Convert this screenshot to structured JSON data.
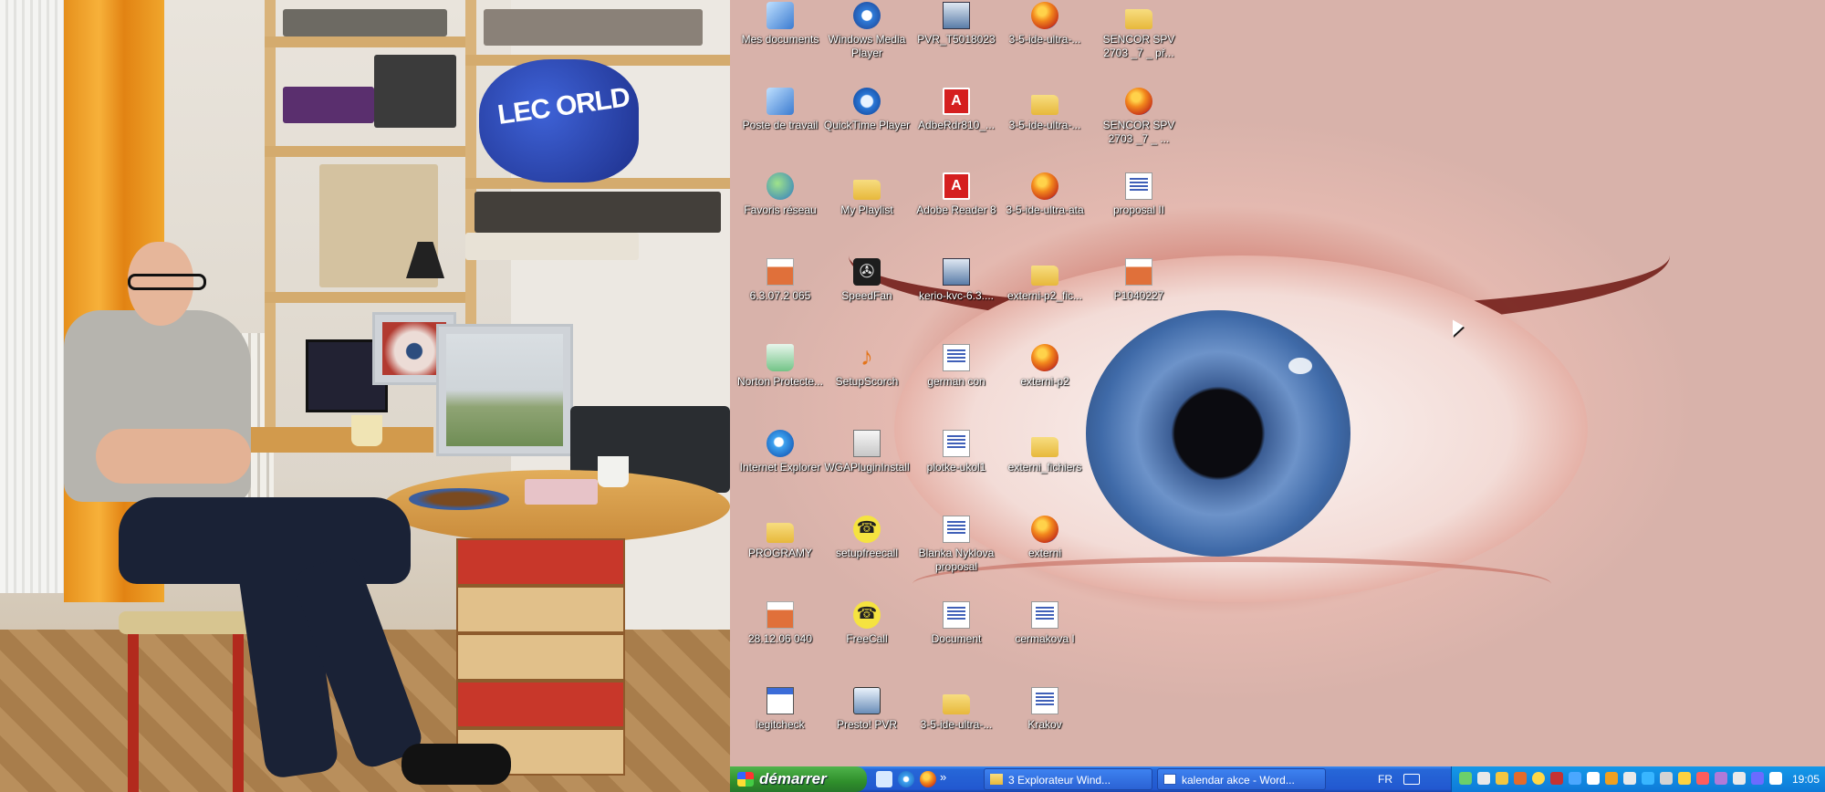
{
  "desktop": {
    "icons": [
      {
        "label": "Mes documents",
        "icon": "folder-docs-icon",
        "type": "sys"
      },
      {
        "label": "Windows Media Player",
        "icon": "windows-media-player-icon",
        "type": "wmp"
      },
      {
        "label": "PVR_T5018023",
        "icon": "pvr-icon",
        "type": "pvr"
      },
      {
        "label": "3-5-ide-ultra-...",
        "icon": "firefox-icon",
        "type": "firefox"
      },
      {
        "label": "SENCOR SPV 2703 _7 _ př...",
        "icon": "folder-icon",
        "type": "folder"
      },
      {
        "label": "Poste de travail",
        "icon": "computer-icon",
        "type": "sys"
      },
      {
        "label": "QuickTime Player",
        "icon": "quicktime-icon",
        "type": "qt"
      },
      {
        "label": "AdbeRdr810_...",
        "icon": "adobe-installer-icon",
        "type": "pdf"
      },
      {
        "label": "3-5-ide-ultra-...",
        "icon": "folder-icon",
        "type": "folder"
      },
      {
        "label": "SENCOR SPV 2703 _7 _ ...",
        "icon": "firefox-icon",
        "type": "firefox"
      },
      {
        "label": "Favoris réseau",
        "icon": "network-icon",
        "type": "net"
      },
      {
        "label": "My Playlist",
        "icon": "folder-icon",
        "type": "folder"
      },
      {
        "label": "Adobe Reader 8",
        "icon": "adobe-reader-icon",
        "type": "pdf"
      },
      {
        "label": "3-5-ide-ultra-ata",
        "icon": "firefox-icon",
        "type": "firefox"
      },
      {
        "label": "proposal II",
        "icon": "document-icon",
        "type": "doc"
      },
      {
        "label": "6.3.07.2 065",
        "icon": "image-icon",
        "type": "img"
      },
      {
        "label": "SpeedFan",
        "icon": "speedfan-icon",
        "type": "fan"
      },
      {
        "label": "kerio-kvc-6.3....",
        "icon": "installer-icon",
        "type": "pvr"
      },
      {
        "label": "externi-p2_fic...",
        "icon": "folder-icon",
        "type": "folder"
      },
      {
        "label": "P1040227",
        "icon": "image-icon",
        "type": "img"
      },
      {
        "label": "Norton Protecte...",
        "icon": "recycle-bin-icon",
        "type": "bin"
      },
      {
        "label": "SetupScorch",
        "icon": "scorch-icon",
        "type": "scorch"
      },
      {
        "label": "german con",
        "icon": "document-icon",
        "type": "doc"
      },
      {
        "label": "externi-p2",
        "icon": "firefox-icon",
        "type": "firefox"
      },
      {
        "label": "Internet Explorer",
        "icon": "internet-explorer-icon",
        "type": "ie"
      },
      {
        "label": "WGAPluginInstall",
        "icon": "wga-installer-icon",
        "type": "wga"
      },
      {
        "label": "plotke-ukol1",
        "icon": "document-icon",
        "type": "doc"
      },
      {
        "label": "externi_fichiers",
        "icon": "folder-icon",
        "type": "folder"
      },
      {
        "label": "PROGRAMY",
        "icon": "folder-icon",
        "type": "folder"
      },
      {
        "label": "setupfreecall",
        "icon": "freecall-icon",
        "type": "phone"
      },
      {
        "label": "Blanka Nyklova proposal",
        "icon": "document-icon",
        "type": "doc"
      },
      {
        "label": "externi",
        "icon": "firefox-icon",
        "type": "firefox"
      },
      {
        "label": "28.12.06 040",
        "icon": "image-icon",
        "type": "img"
      },
      {
        "label": "FreeCall",
        "icon": "freecall-icon",
        "type": "phone"
      },
      {
        "label": "Document",
        "icon": "document-icon",
        "type": "doc"
      },
      {
        "label": "cermakova I",
        "icon": "document-icon",
        "type": "doc"
      },
      {
        "label": "legitcheck",
        "icon": "window-app-icon",
        "type": "win"
      },
      {
        "label": "Presto! PVR",
        "icon": "presto-pvr-icon",
        "type": "preston"
      },
      {
        "label": "3-5-ide-ultra-...",
        "icon": "folder-icon",
        "type": "folder"
      },
      {
        "label": "Krakov",
        "icon": "document-icon",
        "type": "doc"
      }
    ]
  },
  "taskbar": {
    "start_label": "démarrer",
    "quick_launch": [
      "desktop-icon",
      "internet-explorer-icon",
      "firefox-icon"
    ],
    "overflow_label": "»",
    "tasks": [
      {
        "label": "3 Explorateur Wind...",
        "icon": "folder-icon"
      },
      {
        "label": "kalendar akce - Word...",
        "icon": "word-icon"
      }
    ],
    "language": "FR",
    "clock": "19:05"
  },
  "photo": {
    "bag_text": "LEC ORLD"
  },
  "colors": {
    "taskbar": "#2258d0",
    "start": "#2f8f2b",
    "tray": "#0e7ad8",
    "iris": "#3f6aa8"
  }
}
